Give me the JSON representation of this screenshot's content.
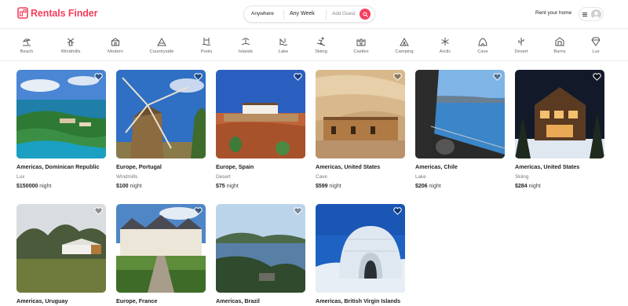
{
  "header": {
    "logo_text": "Rentals Finder",
    "search": {
      "anywhere": "Anywhere",
      "any_week": "Any Week",
      "add_guest": "Add Guest"
    },
    "rent_home": "Rent your home"
  },
  "colors": {
    "brand": "#f43f5e"
  },
  "categories": [
    {
      "label": "Beach",
      "icon": "beach-icon"
    },
    {
      "label": "Windmills",
      "icon": "windmill-icon"
    },
    {
      "label": "Modern",
      "icon": "modern-icon"
    },
    {
      "label": "Countryside",
      "icon": "countryside-icon"
    },
    {
      "label": "Pools",
      "icon": "pool-icon"
    },
    {
      "label": "Islands",
      "icon": "island-icon"
    },
    {
      "label": "Lake",
      "icon": "lake-icon"
    },
    {
      "label": "Skiing",
      "icon": "skiing-icon"
    },
    {
      "label": "Castles",
      "icon": "castle-icon"
    },
    {
      "label": "Camping",
      "icon": "camping-icon"
    },
    {
      "label": "Arctic",
      "icon": "arctic-icon"
    },
    {
      "label": "Cave",
      "icon": "cave-icon"
    },
    {
      "label": "Desert",
      "icon": "desert-icon"
    },
    {
      "label": "Barns",
      "icon": "barn-icon"
    },
    {
      "label": "Lux",
      "icon": "diamond-icon"
    }
  ],
  "listings": [
    {
      "location": "Americas, Dominican Republic",
      "category": "Lux",
      "price": "$150000",
      "per": "night"
    },
    {
      "location": "Europe, Portugal",
      "category": "Windmills",
      "price": "$100",
      "per": "night"
    },
    {
      "location": "Europe, Spain",
      "category": "Desert",
      "price": "$75",
      "per": "night"
    },
    {
      "location": "Americas, United States",
      "category": "Cave",
      "price": "$599",
      "per": "night"
    },
    {
      "location": "Americas, Chile",
      "category": "Lake",
      "price": "$206",
      "per": "night"
    },
    {
      "location": "Americas, United States",
      "category": "Skiing",
      "price": "$284",
      "per": "night"
    },
    {
      "location": "Americas, Uruguay"
    },
    {
      "location": "Europe, France"
    },
    {
      "location": "Americas, Brazil"
    },
    {
      "location": "Americas, British Virgin Islands"
    }
  ]
}
